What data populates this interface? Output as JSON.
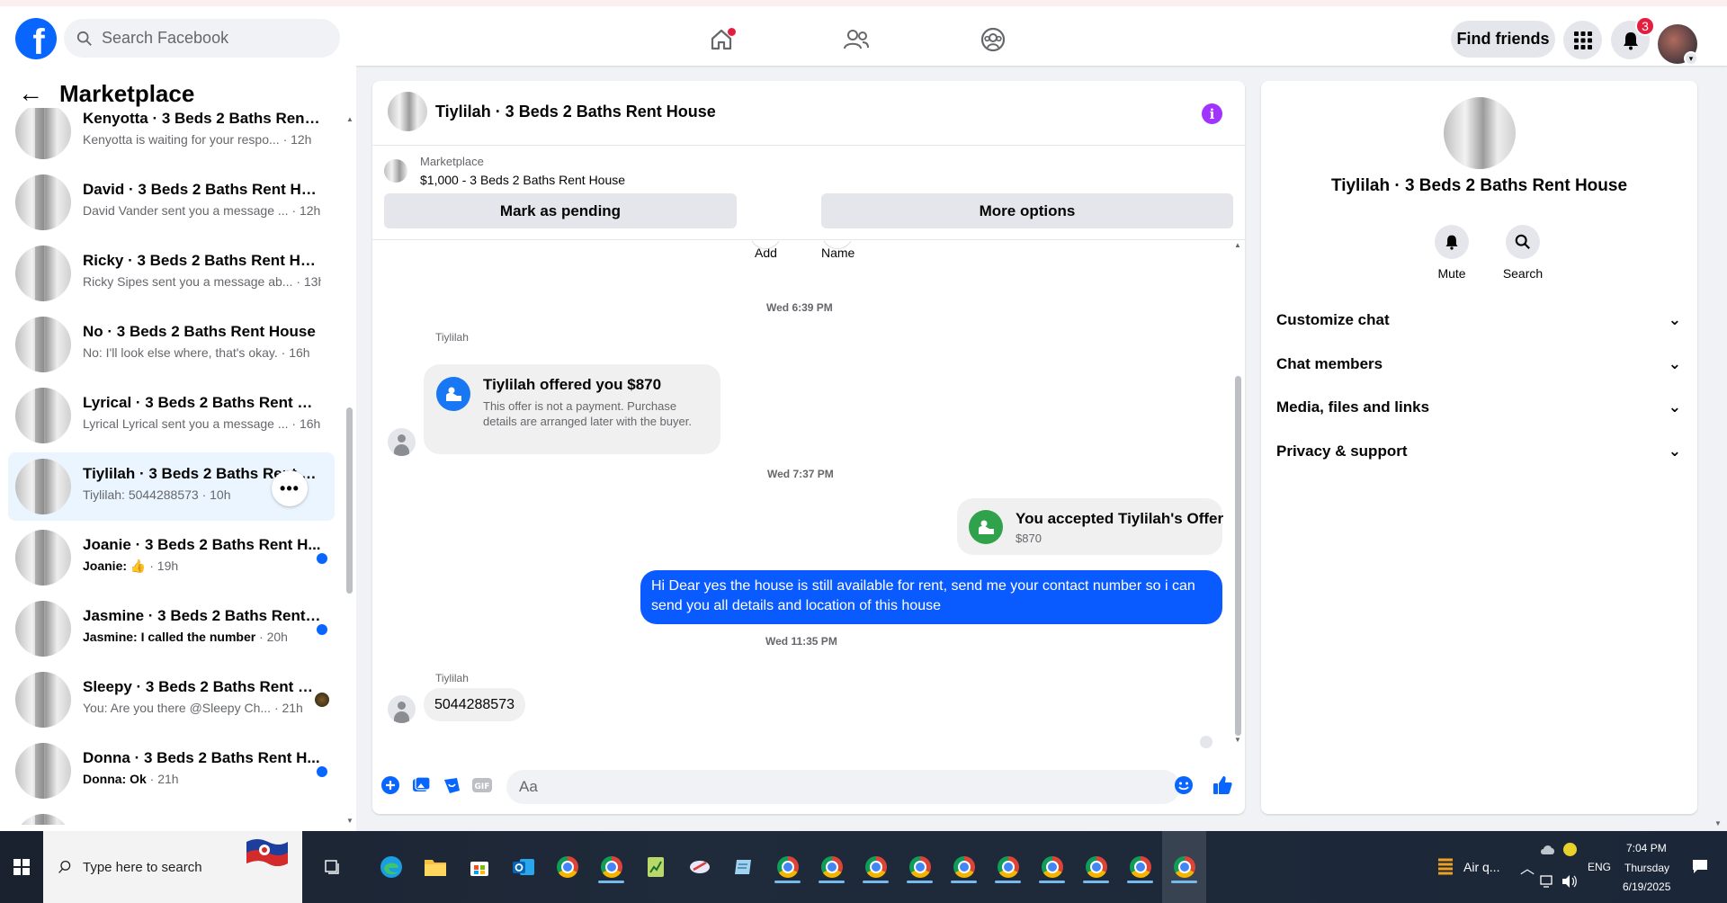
{
  "topbar": {
    "search_placeholder": "Search Facebook",
    "find_friends": "Find friends",
    "notifications_count": "3"
  },
  "left": {
    "back_icon": "arrow-left-icon",
    "title": "Marketplace",
    "conversations": [
      {
        "title": "Kenyotta · 3 Beds 2 Baths Rent H...",
        "preview": "Kenyotta is waiting for your respo...",
        "time": "· 12h",
        "unread": false
      },
      {
        "title": "David · 3 Beds 2 Baths Rent House",
        "preview": "David Vander sent you a message ...",
        "time": "· 12h",
        "unread": false
      },
      {
        "title": "Ricky · 3 Beds 2 Baths Rent House",
        "preview": "Ricky Sipes sent you a message ab...",
        "time": "· 13h",
        "unread": false
      },
      {
        "title": "No · 3 Beds 2 Baths Rent House",
        "preview": "No: I'll look else where, that's okay.",
        "time": "· 16h",
        "unread": false
      },
      {
        "title": "Lyrical · 3 Beds 2 Baths Rent Hou...",
        "preview": "Lyrical Lyrical sent you a message ...",
        "time": "· 16h",
        "unread": false
      },
      {
        "title": "Tiylilah · 3 Beds 2 Baths Rent H...",
        "preview": "Tiylilah: 5044288573",
        "time": "· 10h",
        "unread": false,
        "active": true
      },
      {
        "title": "Joanie · 3 Beds 2 Baths Rent H...",
        "preview": "Joanie: 👍",
        "time": "· 19h",
        "unread": true
      },
      {
        "title": "Jasmine · 3 Beds 2 Baths Rent ...",
        "preview": "Jasmine: I called the number",
        "time": "· 20h",
        "unread": true
      },
      {
        "title": "Sleepy · 3 Beds 2 Baths Rent H...",
        "preview": "You: Are you there @Sleepy Ch...",
        "time": "· 21h",
        "unread": false
      },
      {
        "title": "Donna · 3 Beds 2 Baths Rent H...",
        "preview": "Donna: Ok",
        "time": "· 21h",
        "unread": true
      }
    ]
  },
  "chat": {
    "title": "Tiylilah · 3 Beds 2 Baths Rent House",
    "marketplace_label": "Marketplace",
    "listing": "$1,000 - 3 Beds 2 Baths Rent House",
    "mark_pending": "Mark as pending",
    "more_options": "More options",
    "add_label": "Add",
    "name_label": "Name",
    "ts1": "Wed 6:39 PM",
    "sender1": "Tiylilah",
    "offer_title": "Tiylilah offered you $870",
    "offer_text": "This offer is not a payment. Purchase details are arranged later with the buyer.",
    "ts2": "Wed 7:37 PM",
    "accepted_title": "You accepted Tiylilah's Offer",
    "accepted_amount": "$870",
    "my_message": "Hi Dear yes the house is still available for rent, send me your contact number so i can send you all details and location of this house",
    "ts3": "Wed 11:35 PM",
    "sender2": "Tiylilah",
    "their_message": "5044288573",
    "input_placeholder": "Aa"
  },
  "right": {
    "title": "Tiylilah · 3 Beds 2 Baths Rent House",
    "mute": "Mute",
    "search": "Search",
    "items": [
      "Customize chat",
      "Chat members",
      "Media, files and links",
      "Privacy & support"
    ]
  },
  "taskbar": {
    "search_placeholder": "Type here to search",
    "weather": "Air q...",
    "lang": "ENG",
    "time": "7:04 PM",
    "day": "Thursday",
    "date": "6/19/2025"
  },
  "colors": {
    "brand": "#0866ff",
    "my_bubble": "#0a5bff",
    "offer_icon_blue": "#1877f2",
    "accepted_icon_green": "#31a24c",
    "info_icon": "#a033ff"
  }
}
